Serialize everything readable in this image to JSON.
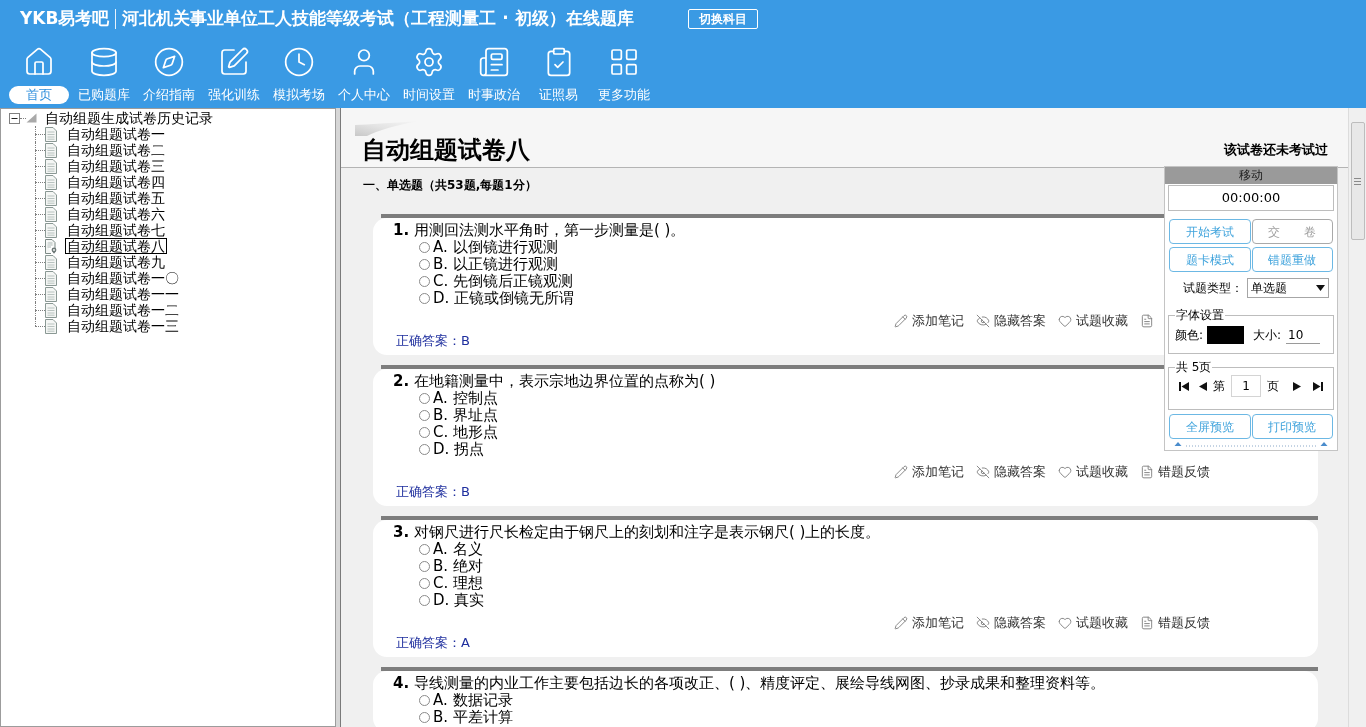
{
  "header": {
    "logo": "YKB易考吧",
    "title": "河北机关事业单位工人技能等级考试（工程测量工 · 初级）在线题库",
    "switch_button": "切换科目"
  },
  "nav": [
    {
      "label": "首页",
      "selected": true
    },
    {
      "label": "已购题库",
      "selected": false
    },
    {
      "label": "介绍指南",
      "selected": false
    },
    {
      "label": "强化训练",
      "selected": false
    },
    {
      "label": "模拟考场",
      "selected": false
    },
    {
      "label": "个人中心",
      "selected": false
    },
    {
      "label": "时间设置",
      "selected": false
    },
    {
      "label": "时事政治",
      "selected": false
    },
    {
      "label": "证照易",
      "selected": false
    },
    {
      "label": "更多功能",
      "selected": false
    }
  ],
  "sidebar": {
    "tree": {
      "label": "自动组题生成试卷历史记录",
      "expanded": true,
      "children": [
        {
          "label": "自动组题试卷一",
          "selected": false
        },
        {
          "label": "自动组题试卷二",
          "selected": false
        },
        {
          "label": "自动组题试卷三",
          "selected": false
        },
        {
          "label": "自动组题试卷四",
          "selected": false
        },
        {
          "label": "自动组题试卷五",
          "selected": false
        },
        {
          "label": "自动组题试卷六",
          "selected": false
        },
        {
          "label": "自动组题试卷七",
          "selected": false
        },
        {
          "label": "自动组题试卷八",
          "selected": true
        },
        {
          "label": "自动组题试卷九",
          "selected": false
        },
        {
          "label": "自动组题试卷一〇",
          "selected": false
        },
        {
          "label": "自动组题试卷一一",
          "selected": false
        },
        {
          "label": "自动组题试卷一二",
          "selected": false
        },
        {
          "label": "自动组题试卷一三",
          "selected": false
        }
      ]
    }
  },
  "exam": {
    "title": "自动组题试卷八",
    "status": "该试卷还未考试过",
    "section": "一、单选题（共53题,每题1分）",
    "questions": [
      {
        "text": "**1.** 用测回法测水平角时，第一步测量是( )。",
        "options": [
          {
            "text": "A. 以倒镜进行观测",
            "selected": false
          },
          {
            "text": "B. 以正镜进行观测",
            "selected": false
          },
          {
            "text": "C. 先倒镜后正镜观测",
            "selected": false
          },
          {
            "text": "D. 正镜或倒镜无所谓",
            "selected": false
          }
        ],
        "actions": [
          {
            "kind": "note",
            "label": "添加笔记"
          },
          {
            "kind": "hide",
            "label": "隐藏答案"
          },
          {
            "kind": "favorite",
            "label": "试题收藏"
          },
          {
            "kind": "feedback"
          }
        ],
        "answer": "正确答案：B"
      },
      {
        "text": "**2.** 在地籍测量中，表示宗地边界位置的点称为( )",
        "options": [
          {
            "text": "A. 控制点",
            "selected": false
          },
          {
            "text": "B. 界址点",
            "selected": false
          },
          {
            "text": "C. 地形点",
            "selected": false
          },
          {
            "text": "D. 拐点",
            "selected": false
          }
        ],
        "actions": [
          {
            "kind": "note",
            "label": "添加笔记"
          },
          {
            "kind": "hide",
            "label": "隐藏答案"
          },
          {
            "kind": "favorite",
            "label": "试题收藏"
          },
          {
            "kind": "feedback",
            "label": "错题反馈"
          }
        ],
        "answer": "正确答案：B"
      },
      {
        "text": "**3.** 对钢尺进行尺长检定由于钢尺上的刻划和注字是表示钢尺( )上的长度。",
        "options": [
          {
            "text": "A. 名义",
            "selected": false
          },
          {
            "text": "B. 绝对",
            "selected": false
          },
          {
            "text": "C. 理想",
            "selected": false
          },
          {
            "text": "D. 真实",
            "selected": false
          }
        ],
        "actions": [
          {
            "kind": "note",
            "label": "添加笔记"
          },
          {
            "kind": "hide",
            "label": "隐藏答案"
          },
          {
            "kind": "favorite",
            "label": "试题收藏"
          },
          {
            "kind": "feedback",
            "label": "错题反馈"
          }
        ],
        "answer": "正确答案：A"
      },
      {
        "text": "**4.** 导线测量的内业工作主要包括边长的各项改正、( )、精度评定、展绘导线网图、抄录成果和整理资料等。",
        "options": [
          {
            "text": "A. 数据记录",
            "selected": false
          },
          {
            "text": "B. 平差计算",
            "selected": false
          }
        ]
      }
    ]
  },
  "panel": {
    "handle": "移动",
    "timer": "00:00:00",
    "buttons": [
      {
        "label": "开始考试",
        "disabled": false
      },
      {
        "label": "交　　卷",
        "disabled": true
      },
      {
        "label": "题卡模式",
        "disabled": false
      },
      {
        "label": "错题重做",
        "disabled": false
      }
    ],
    "type_label": "试题类型：",
    "type_value": "单选题",
    "font": {
      "legend": "字体设置",
      "color_label": "颜色:",
      "color": "#000000",
      "size_label": "大小:",
      "size": "10"
    },
    "pager": {
      "legend": "共 5页",
      "prefix": "第",
      "page": "1",
      "suffix": "页"
    },
    "preview_buttons": [
      {
        "label": "全屏预览",
        "disabled": false
      },
      {
        "label": "打印预览",
        "disabled": false
      }
    ]
  }
}
